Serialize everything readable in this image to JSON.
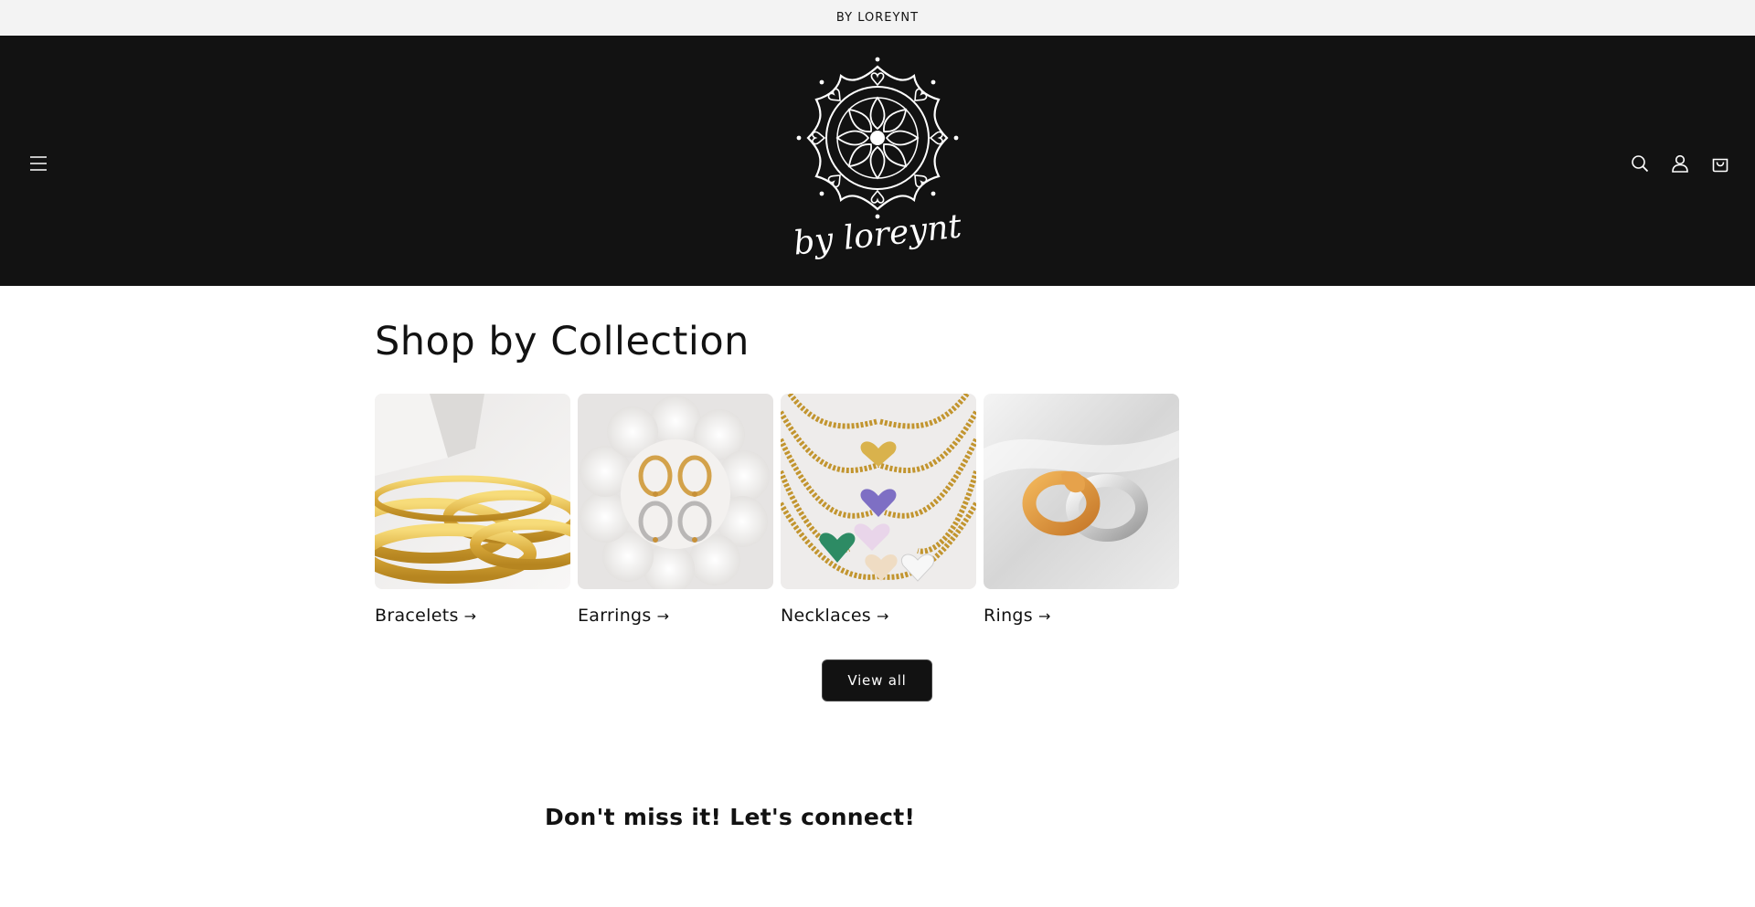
{
  "announcement": {
    "text": "BY LOREYNT"
  },
  "header": {
    "logo_text": "by loreynt",
    "icons": [
      "menu-icon",
      "search-icon",
      "account-icon",
      "cart-icon"
    ]
  },
  "collection": {
    "title": "Shop by Collection",
    "items": [
      {
        "label": "Bracelets",
        "arrow": "→"
      },
      {
        "label": "Earrings",
        "arrow": "→"
      },
      {
        "label": "Necklaces",
        "arrow": "→"
      },
      {
        "label": "Rings",
        "arrow": "→"
      }
    ],
    "view_all": "View all"
  },
  "newsletter": {
    "heading": "Don't miss it! Let's connect!"
  },
  "colors": {
    "header_bg": "#121212",
    "announcement_bg": "#f3f3f3",
    "button_bg": "#121212",
    "text": "#121212"
  }
}
